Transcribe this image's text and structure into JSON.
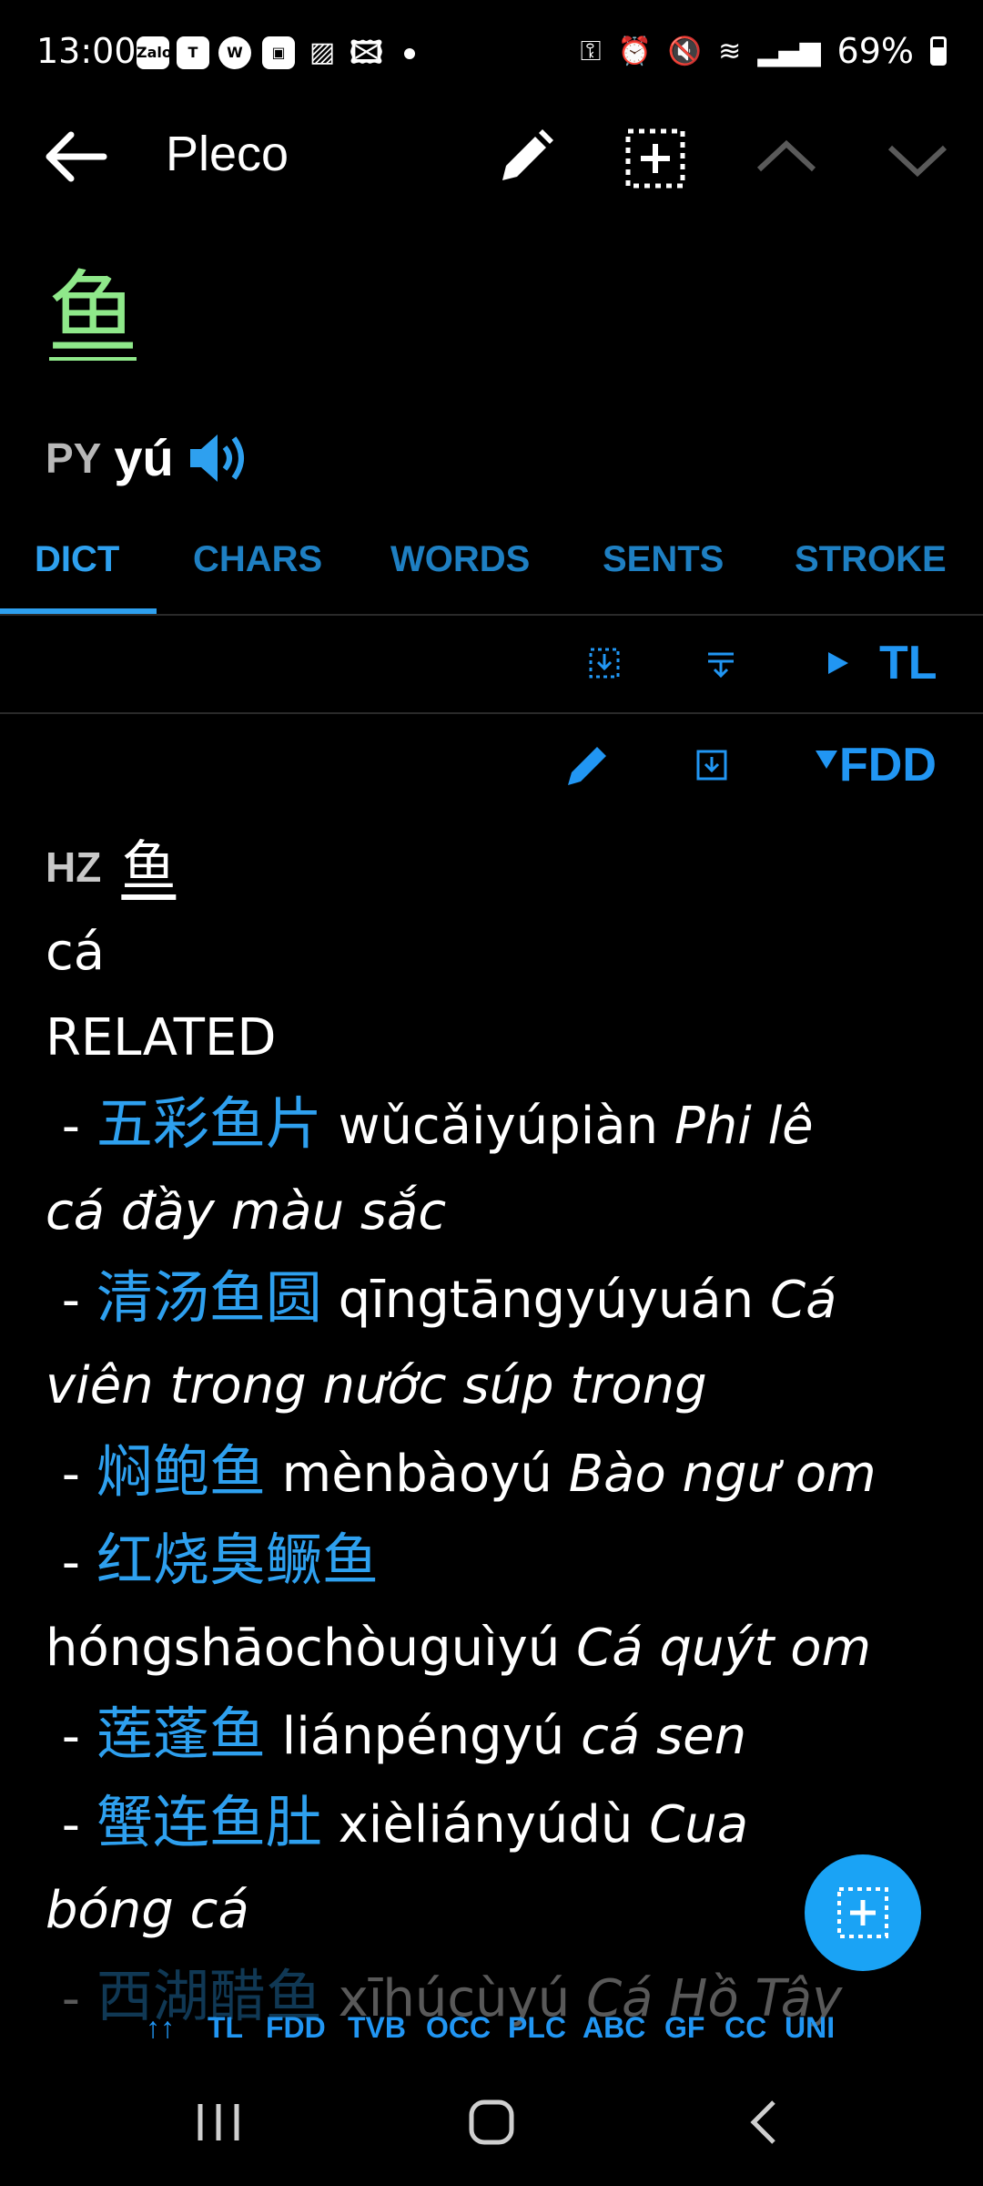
{
  "status_bar": {
    "time": "13:00",
    "app_icons": [
      "Zalo",
      "Teams",
      "W",
      "id",
      "stripes",
      "image"
    ],
    "battery": "69%"
  },
  "app_bar": {
    "title": "Pleco",
    "icons": [
      "back-arrow-icon",
      "edit-pencil-icon",
      "add-flashcard-icon",
      "chevron-up-icon",
      "chevron-down-icon"
    ]
  },
  "entry": {
    "headword": "鱼",
    "pinyin_label": "PY",
    "pinyin": "yú"
  },
  "tabs": [
    {
      "label": "DICT",
      "active": true
    },
    {
      "label": "CHARS",
      "active": false
    },
    {
      "label": "WORDS",
      "active": false
    },
    {
      "label": "SENTS",
      "active": false
    },
    {
      "label": "STROKE",
      "active": false
    }
  ],
  "toolbar1": {
    "dict_label": "TL"
  },
  "toolbar2": {
    "dict_label": "FDD"
  },
  "definition": {
    "hz_label": "HZ",
    "hz_char": "鱼",
    "meaning": "cá",
    "related_label": "RELATED",
    "related": [
      {
        "hanzi": "五彩鱼片",
        "pinyin": "wǔcǎiyúpiàn",
        "trans1": "Phi lê",
        "trans2": "cá đầy màu sắc"
      },
      {
        "hanzi": "清汤鱼圆",
        "pinyin": "qīngtāngyúyuán",
        "trans1": "Cá",
        "trans2": "viên trong nước súp trong"
      },
      {
        "hanzi": "焖鲍鱼",
        "pinyin": "mènbàoyú",
        "trans1": "Bào ngư om"
      },
      {
        "hanzi": "红烧臭鳜鱼",
        "pinyin": "hóngshāochòuguìyú",
        "trans1": "Cá quýt om"
      },
      {
        "hanzi": "莲蓬鱼",
        "pinyin": "liánpéngyú",
        "trans1": "cá sen"
      },
      {
        "hanzi": "蟹连鱼肚",
        "pinyin": "xièliányúdù",
        "trans1": "Cua",
        "trans2": "bóng cá"
      }
    ],
    "partial_line": {
      "hanzi": "西湖醋鱼",
      "pinyin": "xīhúcùyú",
      "trans1": "Cá Hồ Tây"
    }
  },
  "filter_strip": [
    "↑↑",
    "TL",
    "FDD",
    "TVB",
    "OCC",
    "PLC",
    "ABC",
    "GF",
    "CC",
    "UNI"
  ],
  "colors": {
    "accent": "#2196f3",
    "headword": "#8fe88a",
    "hanzi_link": "#2ea0ef",
    "fab": "#1aa3f5"
  }
}
